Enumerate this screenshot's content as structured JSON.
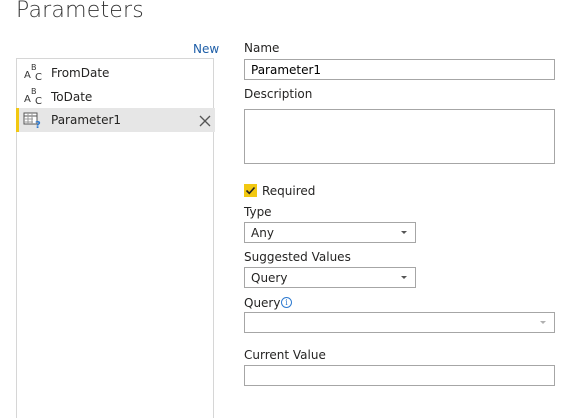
{
  "page": {
    "title": "Parameters",
    "new_label": "New"
  },
  "parameters": [
    {
      "name": "FromDate",
      "icon": "text-type-icon"
    },
    {
      "name": "ToDate",
      "icon": "text-type-icon"
    },
    {
      "name": "Parameter1",
      "icon": "query-parameter-icon",
      "selected": true
    }
  ],
  "form": {
    "name_label": "Name",
    "name_value": "Parameter1",
    "description_label": "Description",
    "description_value": "",
    "required_label": "Required",
    "required_checked": true,
    "type_label": "Type",
    "type_value": "Any",
    "suggested_values_label": "Suggested Values",
    "suggested_values_value": "Query",
    "query_label": "Query",
    "query_info": "i",
    "query_value": "",
    "current_value_label": "Current Value",
    "current_value_value": ""
  },
  "colors": {
    "accent": "#f2c811",
    "link": "#1f5fa8",
    "selected_bg": "#e6e6e6",
    "info": "#2f7bd0"
  }
}
